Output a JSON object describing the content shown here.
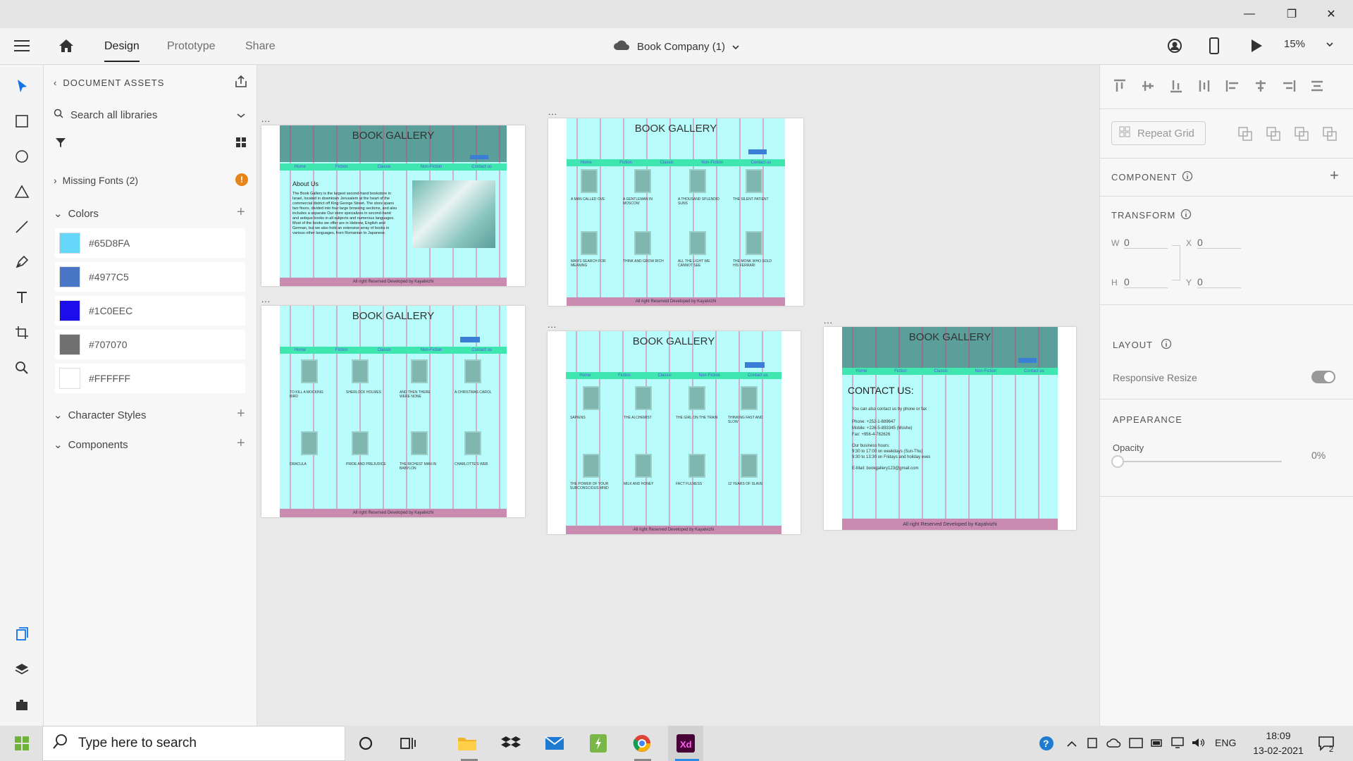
{
  "window": {
    "minimize": "—",
    "maximize": "❐",
    "close": "✕"
  },
  "appbar": {
    "tabs": [
      "Design",
      "Prototype",
      "Share"
    ],
    "doc_title": "Book Company (1)",
    "zoom": "15%"
  },
  "assets": {
    "header": "DOCUMENT ASSETS",
    "search_placeholder": "Search all libraries",
    "missing_fonts": "Missing Fonts (2)",
    "missing_badge": "!",
    "colors_label": "Colors",
    "colors": [
      {
        "hex": "#65D8FA",
        "label": "#65D8FA"
      },
      {
        "hex": "#4977C5",
        "label": "#4977C5"
      },
      {
        "hex": "#1C0EEC",
        "label": "#1C0EEC"
      },
      {
        "hex": "#707070",
        "label": "#707070"
      },
      {
        "hex": "#FFFFFF",
        "label": "#FFFFFF"
      }
    ],
    "character_styles_label": "Character Styles",
    "components_label": "Components"
  },
  "artboards": {
    "site_title": "BOOK GALLERY",
    "nav": [
      "Home",
      "Fiction",
      "Classic",
      "Non-Fiction",
      "Contact us"
    ],
    "footer1": "All right Reserved Developed by Kayalvizhi",
    "about_heading": "About Us",
    "about_text": "The Book Gallery is the largest second-hand bookstore in Israel, located in downtown Jerusalem at the heart of the commercial district off King George Street. The store spans two floors, divided into four large browsing sections, and also includes a separate Our store specializes in second-hand and antique books in all subjects and numerous languages. Most of the books we offer are in Hebrew, English and German, but we also hold an extensive array of books in various other languages, from Romanian to Japanese.",
    "fiction_books": [
      "A MAN CALLED OVE",
      "A GENTLEMAN IN MOSCOW",
      "A THOUSAND SPLENDID SUNS",
      "THE SILENT PATIENT",
      "MAN'S SEARCH FOR MEANING",
      "THINK AND GROW RICH",
      "ALL THE LIGHT WE CANNOT SEE",
      "THE MONK WHO SOLD HIS FERRARI"
    ],
    "classic_books": [
      "TO KILL A MOCKING BIRD",
      "SHERLOCK HOLMES",
      "AND THEN THERE WERE NONE",
      "A CHRISTMAS CAROL",
      "DRACULA",
      "PRIDE AND PREJUDICE",
      "THE RICHEST MAN IN BABYLON",
      "CHARLOTTE'S WEB"
    ],
    "nonfiction_books": [
      "SAPIENS",
      "THE ALCHEMIST",
      "THE GIRL ON THE TRAIN",
      "THINKING FAST AND SLOW",
      "THE POWER OF YOUR SUBCONSCIOUS MIND",
      "MILK AND HONEY",
      "FACT FULNESS",
      "12 YEARS OF SLAVE"
    ],
    "contact_heading": "CONTACT US:",
    "contact_line1": "You can also contact us by phone or fax",
    "contact_phone": "Phone: +252-1-889647",
    "contact_mobile": "Mobile: +226-5-893345 (Moshe)",
    "contact_fax": "Fax: +956-4-782626",
    "contact_hours": "Our business hours:",
    "contact_hours1": "9:30 to 17:00 on weekdays (Sun-Thu)",
    "contact_hours2": "9:30 to 13:30 on Fridays and holiday eves",
    "contact_email": "E-Mail: bookgallery123@gmail.com",
    "footer2": "All right Reserved Developed by Kayalvizhi",
    "dots": "..."
  },
  "props": {
    "repeat_grid": "Repeat Grid",
    "component": "COMPONENT",
    "transform": "TRANSFORM",
    "w_label": "W",
    "w_value": "0",
    "x_label": "X",
    "x_value": "0",
    "h_label": "H",
    "h_value": "0",
    "y_label": "Y",
    "y_value": "0",
    "layout": "LAYOUT",
    "responsive_resize": "Responsive Resize",
    "appearance": "APPEARANCE",
    "opacity_label": "Opacity",
    "opacity_value": "0%"
  },
  "taskbar": {
    "search_placeholder": "Type here to search",
    "lang": "ENG",
    "time": "18:09",
    "date": "13-02-2021",
    "notif_count": "2"
  }
}
